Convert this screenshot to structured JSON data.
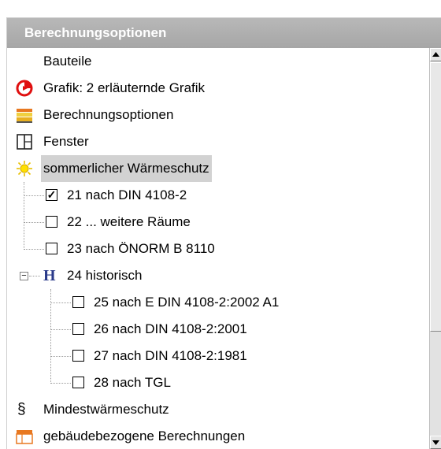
{
  "panel": {
    "title": "Berechnungsoptionen"
  },
  "tree": {
    "top_items": [
      {
        "label": "Bauteile",
        "icon": "none"
      },
      {
        "label": "Grafik: 2 erläuternde Grafik",
        "icon": "graphic-circle-icon"
      },
      {
        "label": "Berechnungsoptionen",
        "icon": "options-stack-icon"
      },
      {
        "label": "Fenster",
        "icon": "window-icon"
      },
      {
        "label": "sommerlicher Wärmeschutz",
        "icon": "sun-icon",
        "selected": true
      }
    ],
    "summer_children": [
      {
        "label": "21 nach DIN 4108-2",
        "checked": true
      },
      {
        "label": "22 ... weitere Räume",
        "checked": false
      },
      {
        "label": "23 nach ÖNORM B 8110",
        "checked": false
      }
    ],
    "historic": {
      "label": "24 historisch",
      "icon": "h-letter-icon",
      "expander": "−"
    },
    "historic_children": [
      {
        "label": "25 nach E DIN 4108-2:2002 A1",
        "checked": false
      },
      {
        "label": "26 nach DIN 4108-2:2001",
        "checked": false
      },
      {
        "label": "27 nach DIN 4108-2:1981",
        "checked": false
      },
      {
        "label": "28 nach TGL",
        "checked": false
      }
    ],
    "bottom_items": [
      {
        "label": "Mindestwärmeschutz",
        "icon": "section-sign-icon",
        "glyph": "§"
      },
      {
        "label": "gebäudebezogene Berechnungen",
        "icon": "building-calc-icon"
      }
    ],
    "checkmark_glyph": "✓"
  },
  "colors": {
    "header_bg": "#a8a8a8",
    "selected_bg": "#d2d2d2",
    "graphic_red": "#e01010",
    "sun_yellow": "#ffe000",
    "h_icon_blue": "#2a3a8a",
    "options_orange": "#e87820"
  }
}
